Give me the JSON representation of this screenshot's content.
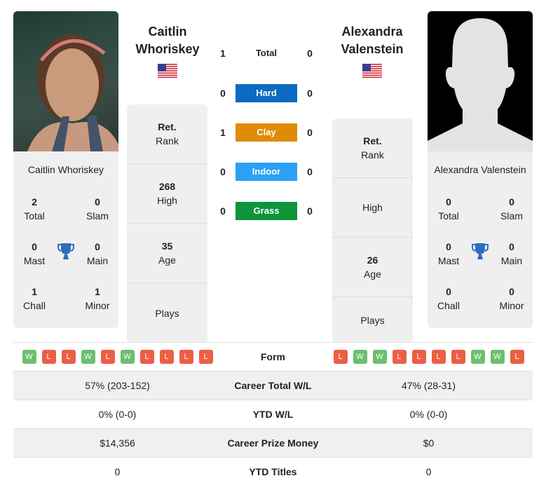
{
  "colors": {
    "hard": "#0a6bc1",
    "clay": "#df8b05",
    "indoor": "#2aa1f5",
    "grass": "#0f943a",
    "win": "#6cbf6e",
    "loss": "#ec5f45",
    "trophy": "#2f6dbd"
  },
  "player1": {
    "name_line1": "Caitlin",
    "name_line2": "Whoriskey",
    "card_name": "Caitlin Whoriskey",
    "country": "USA",
    "titles": {
      "total": {
        "value": "2",
        "label": "Total"
      },
      "slam": {
        "value": "0",
        "label": "Slam"
      },
      "mast": {
        "value": "0",
        "label": "Mast"
      },
      "main": {
        "value": "0",
        "label": "Main"
      },
      "chall": {
        "value": "1",
        "label": "Chall"
      },
      "minor": {
        "value": "1",
        "label": "Minor"
      }
    },
    "info": [
      {
        "value": "Ret.",
        "label": "Rank"
      },
      {
        "value": "268",
        "label": "High"
      },
      {
        "value": "35",
        "label": "Age"
      },
      {
        "value": "",
        "label": "Plays"
      }
    ],
    "form": [
      "W",
      "L",
      "L",
      "W",
      "L",
      "W",
      "L",
      "L",
      "L",
      "L"
    ]
  },
  "player2": {
    "name_line1": "Alexandra",
    "name_line2": "Valenstein",
    "card_name": "Alexandra Valenstein",
    "country": "USA",
    "titles": {
      "total": {
        "value": "0",
        "label": "Total"
      },
      "slam": {
        "value": "0",
        "label": "Slam"
      },
      "mast": {
        "value": "0",
        "label": "Mast"
      },
      "main": {
        "value": "0",
        "label": "Main"
      },
      "chall": {
        "value": "0",
        "label": "Chall"
      },
      "minor": {
        "value": "0",
        "label": "Minor"
      }
    },
    "info": [
      {
        "value": "Ret.",
        "label": "Rank"
      },
      {
        "value": "",
        "label": "High"
      },
      {
        "value": "26",
        "label": "Age"
      },
      {
        "value": "",
        "label": "Plays"
      }
    ],
    "form": [
      "L",
      "W",
      "W",
      "L",
      "L",
      "L",
      "L",
      "W",
      "W",
      "L"
    ]
  },
  "h2h": [
    {
      "label": "Total",
      "p1": "1",
      "p2": "0"
    },
    {
      "label": "Hard",
      "p1": "0",
      "p2": "0"
    },
    {
      "label": "Clay",
      "p1": "1",
      "p2": "0"
    },
    {
      "label": "Indoor",
      "p1": "0",
      "p2": "0"
    },
    {
      "label": "Grass",
      "p1": "0",
      "p2": "0"
    }
  ],
  "stats": {
    "form_label": "Form",
    "rows": [
      {
        "label": "Career Total W/L",
        "p1": "57% (203-152)",
        "p2": "47% (28-31)"
      },
      {
        "label": "YTD W/L",
        "p1": "0% (0-0)",
        "p2": "0% (0-0)"
      },
      {
        "label": "Career Prize Money",
        "p1": "$14,356",
        "p2": "$0"
      },
      {
        "label": "YTD Titles",
        "p1": "0",
        "p2": "0"
      }
    ]
  }
}
